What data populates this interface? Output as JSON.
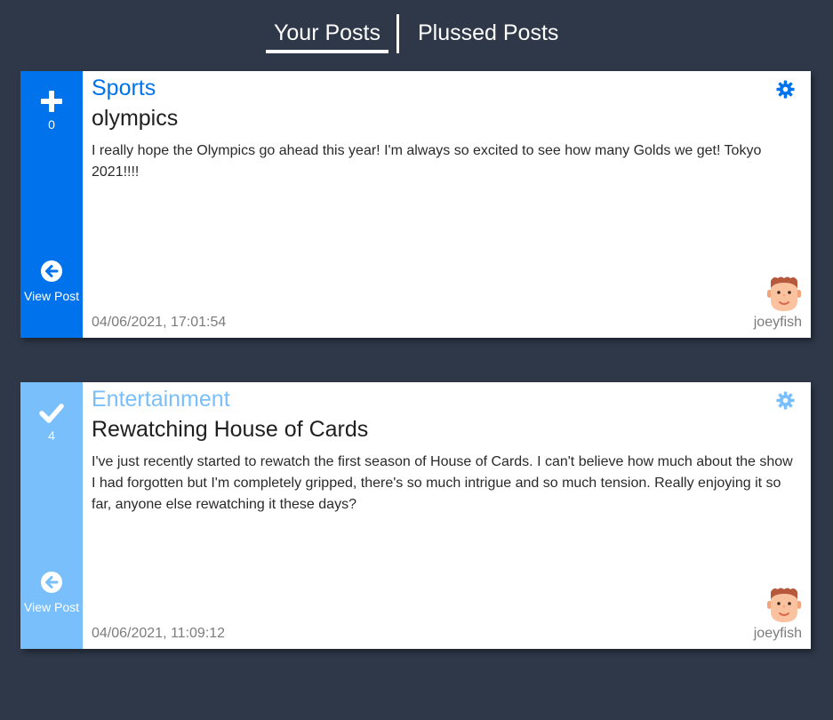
{
  "tabs": [
    {
      "label": "Your Posts",
      "active": true
    },
    {
      "label": "Plussed Posts",
      "active": false
    }
  ],
  "colors": {
    "background": "#2e3849",
    "primary_blue": "#0073ec",
    "light_blue": "#78bffc",
    "card": "#ffffff"
  },
  "posts": [
    {
      "vote_icon": "plus-icon",
      "plus_count": "0",
      "category": "Sports",
      "title": "olympics",
      "body": "I really hope the Olympics go ahead this year! I'm always so excited to see how many Golds we get! Tokyo 2021!!!!",
      "view_label": "View Post",
      "timestamp": "04/06/2021, 17:01:54",
      "author": "joeyfish",
      "plussed": false
    },
    {
      "vote_icon": "check-icon",
      "plus_count": "4",
      "category": "Entertainment",
      "title": "Rewatching House of Cards",
      "body": "I've just recently started to rewatch the first season of House of Cards. I can't believe how much about the show I had forgotten but I'm completely gripped, there's so much intrigue and so much tension. Really enjoying it so far, anyone else rewatching it these days?",
      "view_label": "View Post",
      "timestamp": "04/06/2021, 11:09:12",
      "author": "joeyfish",
      "plussed": true
    }
  ]
}
